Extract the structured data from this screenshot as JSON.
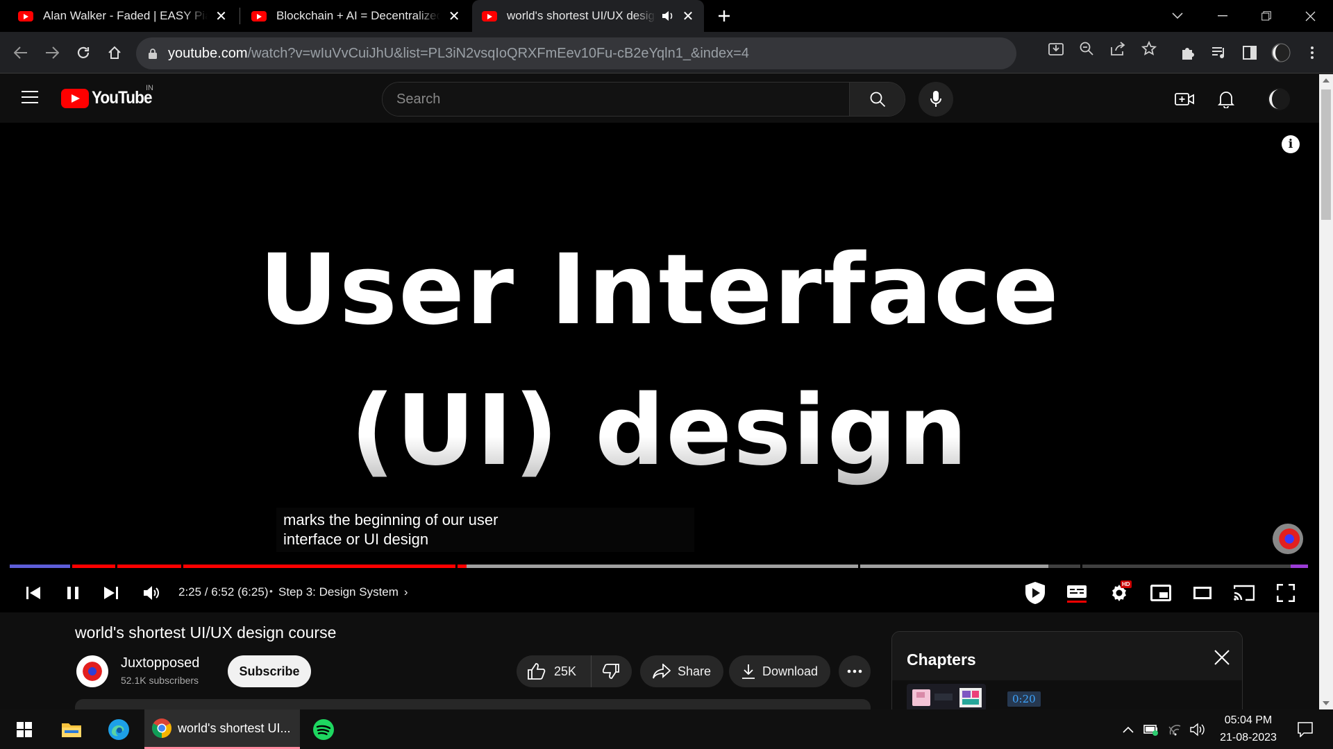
{
  "browser": {
    "tabs": [
      {
        "title": "Alan Walker - Faded | EASY Piano",
        "active": false
      },
      {
        "title": "Blockchain + AI = Decentralized AI",
        "active": false
      },
      {
        "title": "world's shortest UI/UX design course",
        "active": true,
        "audio": true
      }
    ],
    "url_host": "youtube.com",
    "url_path": "/watch?v=wIuVvCuiJhU&list=PL3iN2vsqIoQRXFmEev10Fu-cB2eYqln1_&index=4"
  },
  "youtube": {
    "logo_text": "YouTube",
    "country_code": "IN",
    "search_placeholder": "Search",
    "brand_color": "#ff0000"
  },
  "player": {
    "slide_line_1": "User Interface",
    "slide_line_2": "(UI) design",
    "caption_line_1": "marks the beginning of our user",
    "caption_line_2": "interface or UI design",
    "time": "2:25 / 6:52 (6:25)",
    "separator": "•",
    "chapter": "Step 3: Design System",
    "progress_fraction": 0.352,
    "buffered_fraction": 0.8,
    "quality_badge": "HD"
  },
  "video": {
    "title": "world's shortest UI/UX design course",
    "channel": "Juxtopposed",
    "subscribers": "52.1K subscribers",
    "subscribe_label": "Subscribe",
    "likes": "25K",
    "share_label": "Share",
    "download_label": "Download"
  },
  "chapters_panel": {
    "title": "Chapters",
    "first_time": "0:20"
  },
  "taskbar": {
    "chrome_label": "world's shortest UI...",
    "time": "05:04 PM",
    "date": "21-08-2023"
  }
}
